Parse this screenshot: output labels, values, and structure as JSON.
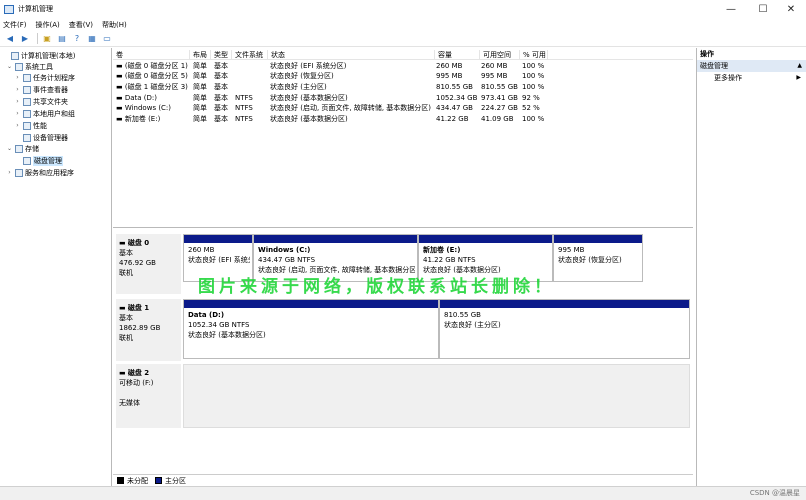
{
  "window": {
    "title": "计算机管理",
    "controls": [
      "—",
      "☐",
      "✕"
    ]
  },
  "menu": [
    "文件(F)",
    "操作(A)",
    "查看(V)",
    "帮助(H)"
  ],
  "tree": [
    {
      "label": "计算机管理(本地)",
      "expander": "",
      "level": 0
    },
    {
      "label": "系统工具",
      "expander": "⌄",
      "level": 1
    },
    {
      "label": "任务计划程序",
      "expander": "›",
      "level": 2
    },
    {
      "label": "事件查看器",
      "expander": "›",
      "level": 2
    },
    {
      "label": "共享文件夹",
      "expander": "›",
      "level": 2
    },
    {
      "label": "本地用户和组",
      "expander": "›",
      "level": 2
    },
    {
      "label": "性能",
      "expander": "›",
      "level": 2
    },
    {
      "label": "设备管理器",
      "expander": "",
      "level": 2
    },
    {
      "label": "存储",
      "expander": "⌄",
      "level": 1
    },
    {
      "label": "磁盘管理",
      "expander": "",
      "level": 2
    },
    {
      "label": "服务和应用程序",
      "expander": "›",
      "level": 1
    }
  ],
  "volumes": {
    "headers": [
      "卷",
      "布局",
      "类型",
      "文件系统",
      "状态",
      "容量",
      "可用空间",
      "% 可用"
    ],
    "rows": [
      [
        "(磁盘 0 磁盘分区 1)",
        "简单",
        "基本",
        "",
        "状态良好 (EFI 系统分区)",
        "260 MB",
        "260 MB",
        "100 %"
      ],
      [
        "(磁盘 0 磁盘分区 5)",
        "简单",
        "基本",
        "",
        "状态良好 (恢复分区)",
        "995 MB",
        "995 MB",
        "100 %"
      ],
      [
        "(磁盘 1 磁盘分区 3)",
        "简单",
        "基本",
        "",
        "状态良好 (主分区)",
        "810.55 GB",
        "810.55 GB",
        "100 %"
      ],
      [
        "Data (D:)",
        "简单",
        "基本",
        "NTFS",
        "状态良好 (基本数据分区)",
        "1052.34 GB",
        "973.41 GB",
        "92 %"
      ],
      [
        "Windows (C:)",
        "简单",
        "基本",
        "NTFS",
        "状态良好 (启动, 页面文件, 故障转储, 基本数据分区)",
        "434.47 GB",
        "224.27 GB",
        "52 %"
      ],
      [
        "新加卷 (E:)",
        "简单",
        "基本",
        "NTFS",
        "状态良好 (基本数据分区)",
        "41.22 GB",
        "41.09 GB",
        "100 %"
      ]
    ]
  },
  "disks": [
    {
      "name": "磁盘 0",
      "type": "基本",
      "size": "476.92 GB",
      "state": "联机",
      "partitions": [
        {
          "name": "",
          "size": "260 MB",
          "status": "状态良好 (EFI 系统分"
        },
        {
          "name": "Windows (C:)",
          "size": "434.47 GB NTFS",
          "status": "状态良好 (启动, 页面文件, 故障转储, 基本数据分区"
        },
        {
          "name": "新加卷 (E:)",
          "size": "41.22 GB NTFS",
          "status": "状态良好 (基本数据分区)"
        },
        {
          "name": "",
          "size": "995 MB",
          "status": "状态良好 (恢复分区)"
        }
      ]
    },
    {
      "name": "磁盘 1",
      "type": "基本",
      "size": "1862.89 GB",
      "state": "联机",
      "partitions": [
        {
          "name": "Data (D:)",
          "size": "1052.34 GB NTFS",
          "status": "状态良好 (基本数据分区)"
        },
        {
          "name": "",
          "size": "810.55 GB",
          "status": "状态良好 (主分区)"
        }
      ]
    },
    {
      "name": "磁盘 2",
      "type": "可移动 (F:)",
      "size": "",
      "state": "无媒体",
      "partitions": []
    }
  ],
  "legend": [
    "未分配",
    "主分区"
  ],
  "actions": {
    "header": "操作",
    "section": "磁盘管理",
    "more": "更多操作"
  },
  "watermark": "图片来源于网络，版权联系站长删除！",
  "credit": "CSDN @温晨星",
  "colors": {
    "partition_bar": "#0b1a8a",
    "watermark": "#22d63a",
    "selection": "#cce8ff"
  }
}
